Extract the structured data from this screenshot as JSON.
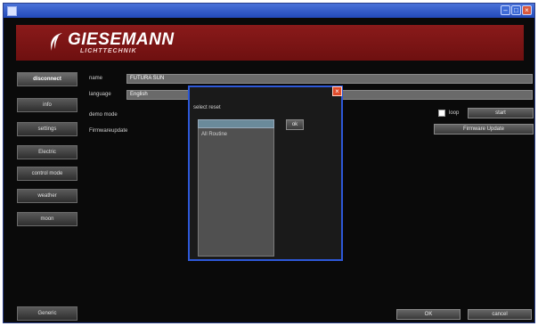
{
  "window": {
    "title": "",
    "minimize_label": "–",
    "maximize_label": "□",
    "close_label": "×"
  },
  "brand": {
    "name": "GIESEMANN",
    "subtitle": "LICHTTECHNIK",
    "accent_color": "#8a1a1a"
  },
  "sidebar": {
    "items": [
      {
        "label": "disconnect"
      },
      {
        "label": "info"
      },
      {
        "label": "settings"
      },
      {
        "label": "Electric"
      },
      {
        "label": "control mode"
      },
      {
        "label": "weather"
      },
      {
        "label": "moon"
      }
    ],
    "bottom_label": "Generic"
  },
  "form": {
    "name_label": "name",
    "name_value": "FUTURA SUN",
    "language_label": "language",
    "language_value": "English",
    "demo_label": "demo mode",
    "firmware_label": "Firmwareupdate",
    "loop_label": "loop",
    "start_label": "start",
    "firmware_button": "Firmware Update"
  },
  "dialog": {
    "title": "",
    "select_label": "select reset",
    "ok_label": "ok",
    "close_label": "×",
    "input_value": "",
    "list_items": [
      "All Routine"
    ]
  },
  "footer": {
    "ok_label": "OK",
    "cancel_label": "cancel"
  }
}
